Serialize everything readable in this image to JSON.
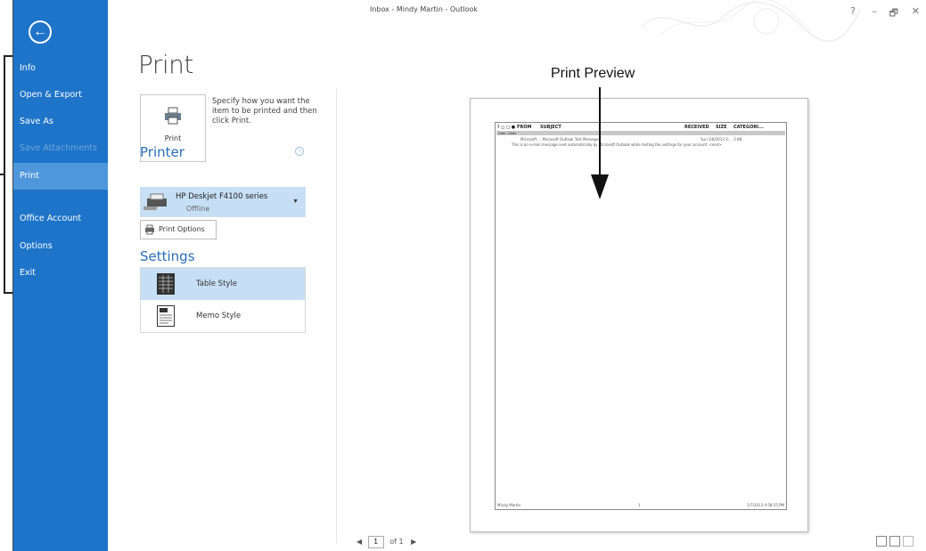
{
  "window": {
    "title": "Inbox - Mindy Martin - Outlook"
  },
  "window_controls": {
    "help": "?",
    "minimize": "–",
    "restore": "🗗",
    "close": "✕"
  },
  "backstage": {
    "back_icon": "back-arrow-icon",
    "items": [
      {
        "label": "Info"
      },
      {
        "label": "Open & Export"
      },
      {
        "label": "Save As"
      },
      {
        "label": "Save Attachments"
      },
      {
        "label": "Print"
      },
      {
        "label": "Office Account"
      },
      {
        "label": "Options"
      },
      {
        "label": "Exit"
      }
    ]
  },
  "main": {
    "title": "Print",
    "print_button": {
      "label": "Print",
      "description": "Specify how you want the item to be printed and then click Print."
    },
    "printer_heading": "Printer",
    "printer": {
      "name": "HP Deskjet F4100 series",
      "status": "Offline"
    },
    "print_options_label": "Print Options",
    "settings_heading": "Settings",
    "styles": [
      {
        "label": "Table Style",
        "selected": true
      },
      {
        "label": "Memo Style",
        "selected": false
      }
    ]
  },
  "preview": {
    "annotation": "Print Preview",
    "header_cols": [
      "FROM",
      "SUBJECT",
      "RECEIVED",
      "SIZE",
      "CATEGORI..."
    ],
    "group_row": "Date: Older",
    "row1": "Microsoft ... Microsoft Outlook Test Message",
    "row1_date": "Sun 1/6/2013 3:... 3 KB",
    "row2": "This is an e-mail message sent automatically by Microsoft Outlook while testing the settings for your account.  <end>",
    "footer_left": "Mindy Martin",
    "footer_center": "1",
    "footer_right": "1/7/2013 4:58:55 PM"
  },
  "pager": {
    "current": "1",
    "of_label": "of 1"
  }
}
